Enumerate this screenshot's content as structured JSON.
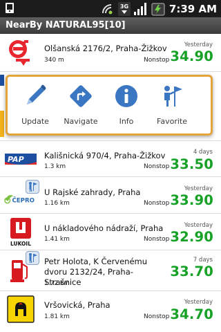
{
  "status_bar": {
    "time": "7:39 AM",
    "network": "3G",
    "icons": [
      "notification-icon",
      "wifi-icon",
      "3g-icon",
      "signal-icon",
      "battery-icon"
    ]
  },
  "title": "NearBy NATURAL95[10]",
  "popup": {
    "actions": [
      {
        "label": "Update",
        "icon": "pencil-icon"
      },
      {
        "label": "Navigate",
        "icon": "navigate-icon"
      },
      {
        "label": "Info",
        "icon": "info-icon"
      },
      {
        "label": "Favorite",
        "icon": "favorite-icon"
      }
    ]
  },
  "stations": [
    {
      "logo": "mol-logo",
      "name": "Olšanská 2176/2, Praha-Žižkov",
      "distance": "340 m",
      "hours": "Nonstop",
      "updated": "Yesterday",
      "price": "34.90"
    },
    {
      "logo": "paramo-logo",
      "logo_text": "PAP",
      "name": "Kališnická 970/4, Praha-Žižkov",
      "distance": "1.3 km",
      "hours": "Nonstop",
      "updated": "4 days",
      "price": "33.50"
    },
    {
      "logo": "cepro-logo",
      "logo_text": "ČEPRO",
      "name": "U Rajské zahrady, Praha",
      "distance": "1.16 km",
      "hours": "Nonstop",
      "updated": "Yesterday",
      "price": "33.90",
      "favorite": true
    },
    {
      "logo": "lukoil-logo",
      "logo_text": "LUKOIL",
      "name": "U nákladového nádraží, Praha",
      "distance": "1.41 km",
      "hours": "Nonstop",
      "updated": "Yesterday",
      "price": "32.90"
    },
    {
      "logo": "fuel-pump-logo",
      "name": "Petr Holota, K Červenému dvoru 2132/24, Praha-Strašnice",
      "distance": "1.72 km",
      "hours": "",
      "updated": "7 days",
      "price": "33.70",
      "favorite": true
    },
    {
      "logo": "agip-logo",
      "name": "Vršovická, Praha",
      "distance": "1.81 km",
      "hours": "Nonstop",
      "updated": "Yesterday",
      "price": "34.70"
    }
  ],
  "colors": {
    "price": "#17a127",
    "popup_border": "#e4a43c",
    "title_bar": "#4a4a4a",
    "icon_blue": "#3a76c2"
  }
}
